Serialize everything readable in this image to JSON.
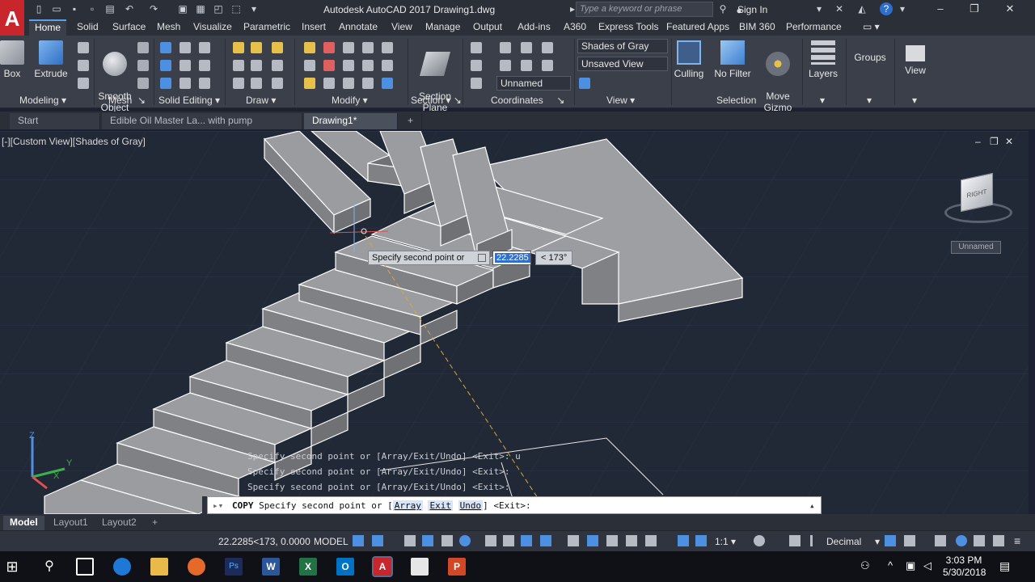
{
  "title_bar": {
    "app_letter": "A",
    "window_title": "Autodesk AutoCAD 2017    Drawing1.dwg",
    "search_placeholder": "Type a keyword or phrase",
    "sign_in": "Sign In"
  },
  "ribbon_tabs": [
    "Home",
    "Solid",
    "Surface",
    "Mesh",
    "Visualize",
    "Parametric",
    "Insert",
    "Annotate",
    "View",
    "Manage",
    "Output",
    "Add-ins",
    "A360",
    "Express Tools",
    "Featured Apps",
    "BIM 360",
    "Performance"
  ],
  "ribbon": {
    "tools": {
      "box": "Box",
      "extrude": "Extrude",
      "smooth_object": "Smooth\nObject",
      "section_plane": "Section\nPlane",
      "culling": "Culling",
      "no_filter": "No Filter",
      "move_gizmo": "Move\nGizmo",
      "layers": "Layers",
      "groups": "Groups",
      "view": "View"
    },
    "dropdowns": {
      "visual_style": "Shades of Gray",
      "named_view": "Unsaved View",
      "ucs": "Unnamed"
    },
    "panels": [
      "Modeling",
      "Mesh",
      "Solid Editing",
      "Draw",
      "Modify",
      "Section",
      "Coordinates",
      "View",
      "Selection"
    ]
  },
  "doc_tabs": [
    "Start",
    "Edible Oil Master La... with pump padestal*",
    "Drawing1*"
  ],
  "viewport": {
    "label": "[-][Custom View][Shades of Gray]",
    "viewcube_face": "RIGHT",
    "ucs_name": "Unnamed",
    "ucs_axis_z": "Z",
    "ucs_axis_x": "X",
    "ucs_axis_y": "Y"
  },
  "dynamic_input": {
    "prompt": "Specify second point or",
    "value": "22.2285",
    "angle": "< 173°"
  },
  "command_history": [
    "Specify second point or [Array/Exit/Undo] <Exit>: u",
    "Specify second point or [Array/Exit/Undo] <Exit>:",
    "Specify second point or [Array/Exit/Undo] <Exit>:"
  ],
  "command_line": {
    "command": "COPY",
    "prompt": "Specify second point or [",
    "options": [
      "Array",
      "Exit",
      "Undo"
    ],
    "suffix": "] <Exit>:"
  },
  "layout_tabs": [
    "Model",
    "Layout1",
    "Layout2"
  ],
  "status_bar": {
    "coords": "22.2285<173, 0.0000",
    "space": "MODEL",
    "scale": "1:1",
    "units": "Decimal"
  },
  "taskbar": {
    "time": "3:03 PM",
    "date": "5/30/2018"
  }
}
